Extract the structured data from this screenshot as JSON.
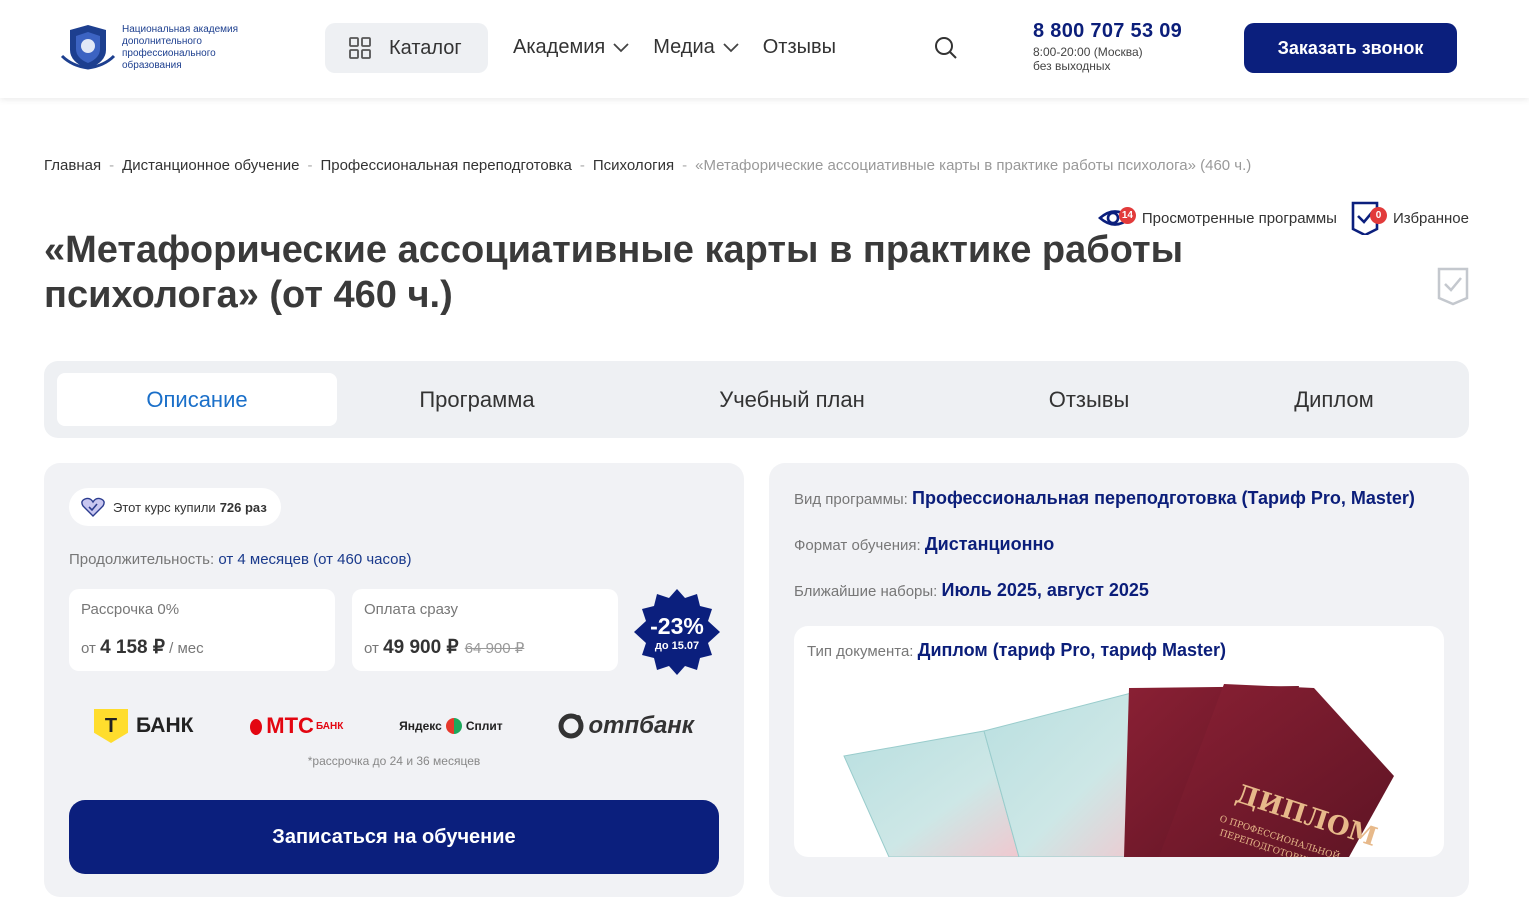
{
  "header": {
    "logo_text": "Национальная академия дополнительного профессионального образования",
    "catalog_label": "Каталог",
    "nav": [
      {
        "label": "Академия",
        "has_dropdown": true
      },
      {
        "label": "Медиа",
        "has_dropdown": true
      },
      {
        "label": "Отзывы",
        "has_dropdown": false
      }
    ],
    "phone": "8 800 707 53 09",
    "hours": "8:00-20:00 (Москва)",
    "days": "без выходных",
    "call_button": "Заказать звонок"
  },
  "breadcrumbs": [
    "Главная",
    "Дистанционное обучение",
    "Профессиональная переподготовка",
    "Психология",
    "«Метафорические ассоциативные карты в практике работы психолога» (460 ч.)"
  ],
  "meta": {
    "viewed_label": "Просмотренные программы",
    "viewed_count": "14",
    "favorites_label": "Избранное",
    "favorites_count": "0"
  },
  "title": "«Метафорические ассоциативные карты в практике работы психолога» (от 460 ч.)",
  "tabs": [
    "Описание",
    "Программа",
    "Учебный план",
    "Отзывы",
    "Диплом"
  ],
  "purchase": {
    "bought_prefix": "Этот курс купили",
    "bought_count": "726 раз",
    "duration_label": "Продолжительность:",
    "duration_value": "от 4 месяцев (от 460 часов)",
    "installment_title": "Рассрочка 0%",
    "installment_prefix": "от",
    "installment_price": "4 158 ₽",
    "installment_suffix": "/ мес",
    "full_title": "Оплата сразу",
    "full_prefix": "от",
    "full_price": "49 900 ₽",
    "full_old_price": "64 900 ₽",
    "discount": "-23%",
    "discount_until": "до 15.07",
    "banks": {
      "tbank": "БАНК",
      "tbank_letter": "Т",
      "mts": "МТС",
      "mts_sup": "БАНК",
      "yandex": "Яндекс",
      "split": "Сплит",
      "otp": "отпбанк"
    },
    "installment_note": "*рассрочка до 24 и 36 месяцев",
    "enroll_button": "Записаться на обучение"
  },
  "program_info": {
    "type_label": "Вид программы:",
    "type_value": "Профессиональная переподготовка (Тариф Pro, Master)",
    "format_label": "Формат обучения:",
    "format_value": "Дистанционно",
    "intake_label": "Ближайшие наборы:",
    "intake_value": "Июль 2025, август 2025",
    "doc_label": "Тип документа:",
    "doc_value": "Диплом (тариф Pro, тариф Master)",
    "diploma_text": "ДИПЛОМ",
    "diploma_sub1": "О ПРОФЕССИОНАЛЬНОЙ",
    "diploma_sub2": "ПЕРЕПОДГОТОВКЕ"
  },
  "colors": {
    "brand_navy": "#0b1f7d",
    "link_blue": "#1a6fc9",
    "badge_red": "#e23b3b",
    "panel_bg": "#f1f2f5"
  }
}
